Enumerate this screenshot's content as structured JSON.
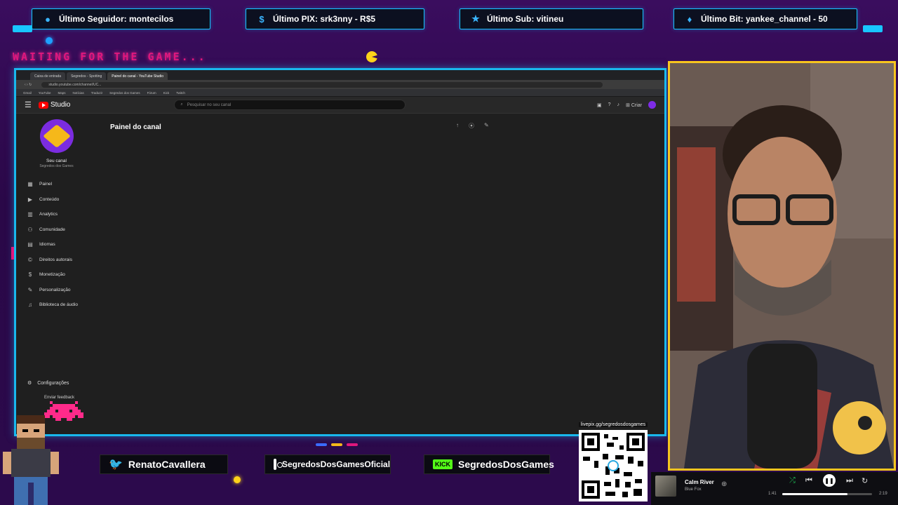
{
  "alerts": {
    "follower": {
      "icon": "person-icon",
      "text": "Último Seguidor: montecilos"
    },
    "pix": {
      "icon": "dollar-icon",
      "text": "Último PIX: srk3nny - R$5"
    },
    "sub": {
      "icon": "star-icon",
      "text": "Último Sub: vitineu"
    },
    "bit": {
      "icon": "diamond-icon",
      "text": "Último Bit: yankee_channel - 50"
    }
  },
  "overlay": {
    "waiting_text": "WAITING FOR THE GAME...",
    "accent_color": "#e0177d",
    "frame_color": "#19b8ee",
    "cam_border_color": "#f7c51e"
  },
  "browser": {
    "tabs": [
      "Caixa de entrada",
      "Segredos - Spotting",
      "Painel do canal - YouTube Studio"
    ],
    "url": "studio.youtube.com/channel/UC...",
    "bookmarks": [
      "Gmail",
      "YouTube",
      "Maps",
      "Notícias",
      "Traduzir",
      "Segredos dos Games",
      "Fórum",
      "Kick",
      "Twitch"
    ]
  },
  "studio": {
    "logo_text": "Studio",
    "search_placeholder": "Pesquisar no seu canal",
    "create_label": "Criar",
    "page_title": "Painel do canal",
    "channel_label": "Seu canal",
    "channel_name": "Segredos dos Games",
    "menu": [
      {
        "label": "Painel",
        "icon": "dashboard-icon",
        "glyph": "▦"
      },
      {
        "label": "Conteúdo",
        "icon": "content-icon",
        "glyph": "▶"
      },
      {
        "label": "Analytics",
        "icon": "analytics-icon",
        "glyph": "▥"
      },
      {
        "label": "Comunidade",
        "icon": "community-icon",
        "glyph": "⚇"
      },
      {
        "label": "Idiomas",
        "icon": "languages-icon",
        "glyph": "▤"
      },
      {
        "label": "Direitos autorais",
        "icon": "copyright-icon",
        "glyph": "©"
      },
      {
        "label": "Monetização",
        "icon": "monetization-icon",
        "glyph": "$"
      },
      {
        "label": "Personalização",
        "icon": "customization-icon",
        "glyph": "✎"
      },
      {
        "label": "Biblioteca de áudio",
        "icon": "audio-library-icon",
        "glyph": "♫"
      }
    ],
    "settings_label": "Configurações",
    "feedback_label": "Enviar feedback"
  },
  "socials": {
    "twitter": "RenatoCavallera",
    "instagram": "SegredosDosGamesOficial",
    "kick_badge": "KICK",
    "kick": "SegredosDosGames"
  },
  "qr": {
    "url": "livepix.gg/segredosdosgames"
  },
  "player": {
    "title": "Calm River",
    "artist": "Blue Fox",
    "time_current": "1:41",
    "time_total": "2:19",
    "progress": 0.73
  }
}
